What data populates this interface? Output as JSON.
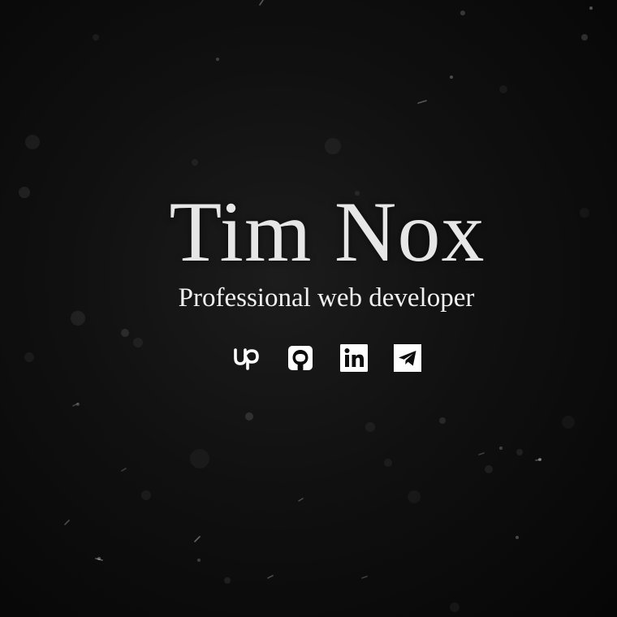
{
  "profile": {
    "name": "Tim Nox",
    "tagline": "Professional web developer"
  },
  "socials": [
    {
      "id": "upwork",
      "icon": "upwork-icon"
    },
    {
      "id": "github",
      "icon": "github-icon"
    },
    {
      "id": "linkedin",
      "icon": "linkedin-icon"
    },
    {
      "id": "telegram",
      "icon": "telegram-icon"
    }
  ],
  "colors": {
    "background": "#0b0b0b",
    "text": "#ececec",
    "icon": "#ffffff"
  }
}
